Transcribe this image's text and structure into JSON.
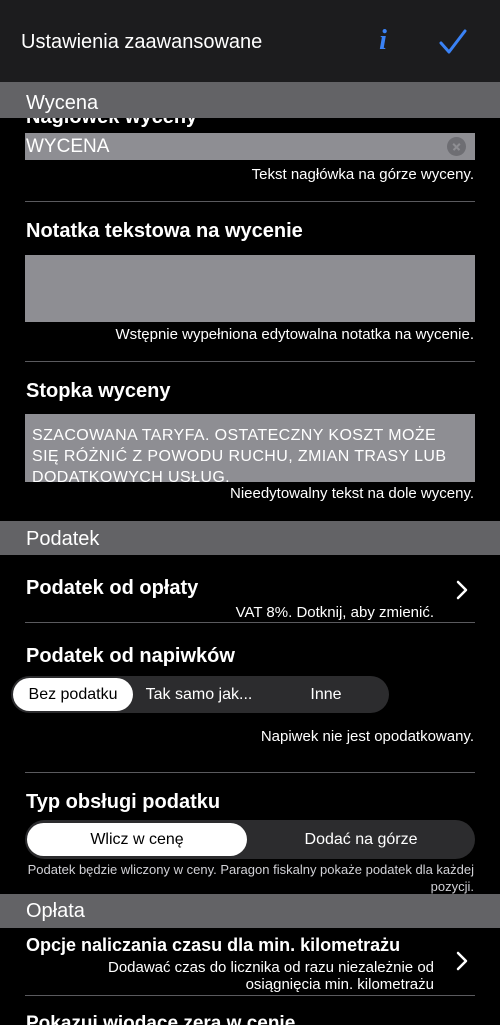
{
  "navbar": {
    "title": "Ustawienia zaawansowane",
    "info_glyph": "i"
  },
  "sections": {
    "wycena": "Wycena",
    "podatek": "Podatek",
    "oplata": "Opłata"
  },
  "quote_header": {
    "label": "Nagłówek wyceny",
    "value": "WYCENA",
    "hint": "Tekst nagłówka na górze wyceny."
  },
  "quote_note": {
    "label": "Notatka tekstowa na wycenie",
    "value": "",
    "hint": "Wstępnie wypełniona edytowalna notatka na wycenie."
  },
  "quote_footer": {
    "label": "Stopka wyceny",
    "value": "SZACOWANA TARYFA. OSTATECZNY KOSZT MOŻE SIĘ RÓŻNIĆ Z POWODU RUCHU, ZMIAN TRASY LUB DODATKOWYCH USŁUG.",
    "hint": "Nieedytowalny tekst na dole wyceny."
  },
  "fare_tax": {
    "label": "Podatek od opłaty",
    "hint": "VAT 8%. Dotknij, aby zmienić."
  },
  "tip_tax": {
    "label": "Podatek od napiwków",
    "options": [
      "Bez podatku",
      "Tak samo jak...",
      "Inne"
    ],
    "selected": "Bez podatku",
    "hint": "Napiwek nie jest opodatkowany."
  },
  "tax_handling": {
    "label": "Typ obsługi podatku",
    "options": [
      "Wlicz w cenę",
      "Dodać na górze"
    ],
    "selected": "Wlicz w cenę",
    "hint": "Podatek będzie wliczony w ceny. Paragon fiskalny pokaże podatek dla każdej pozycji."
  },
  "time_options": {
    "label": "Opcje naliczania czasu dla min. kilometrażu",
    "hint": "Dodawać czas do licznika od razu niezależnie od osiągnięcia min. kilometrażu"
  },
  "leading_zeros": {
    "label": "Pokazuj wiodące zera w cenie"
  },
  "colors": {
    "accent": "#3a82f6",
    "section_bg": "#636366",
    "field_bg": "#8e8e93",
    "background": "#000000",
    "navbar_bg": "#1c1c1e"
  }
}
